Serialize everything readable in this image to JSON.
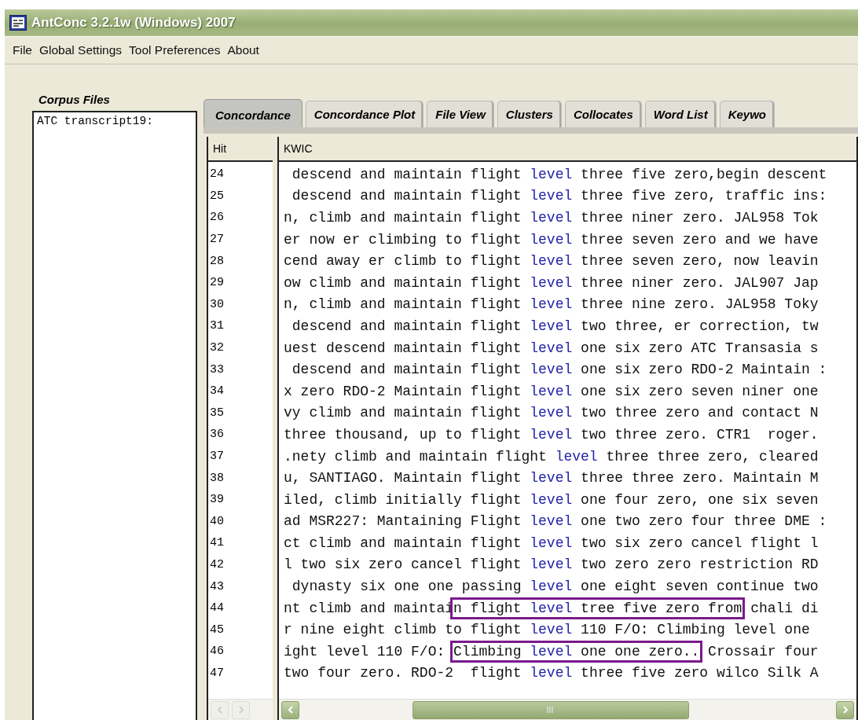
{
  "window": {
    "title": "AntConc 3.2.1w (Windows) 2007"
  },
  "menu": [
    "File",
    "Global Settings",
    "Tool Preferences",
    "About"
  ],
  "corpus_files": {
    "label": "Corpus Files",
    "items": [
      "ATC transcript19:"
    ]
  },
  "tabs": [
    {
      "label": "Concordance",
      "selected": true
    },
    {
      "label": "Concordance Plot",
      "selected": false
    },
    {
      "label": "File View",
      "selected": false
    },
    {
      "label": "Clusters",
      "selected": false
    },
    {
      "label": "Collocates",
      "selected": false
    },
    {
      "label": "Word List",
      "selected": false
    },
    {
      "label": "Keywo",
      "selected": false
    }
  ],
  "table": {
    "columns": [
      "Hit",
      "KWIC"
    ],
    "rows": [
      {
        "hit": "24",
        "parts": [
          {
            "text": " descend and maintain flight ",
            "kind": "context",
            "boxed": false
          },
          {
            "text": "level",
            "kind": "keyword",
            "boxed": false
          },
          {
            "text": " three five zero,begin descent",
            "kind": "context",
            "boxed": false
          }
        ]
      },
      {
        "hit": "25",
        "parts": [
          {
            "text": " descend and maintain flight ",
            "kind": "context",
            "boxed": false
          },
          {
            "text": "level",
            "kind": "keyword",
            "boxed": false
          },
          {
            "text": " three five zero, traffic ins:",
            "kind": "context",
            "boxed": false
          }
        ]
      },
      {
        "hit": "26",
        "parts": [
          {
            "text": "n, climb and maintain flight ",
            "kind": "context",
            "boxed": false
          },
          {
            "text": "level",
            "kind": "keyword",
            "boxed": false
          },
          {
            "text": " three niner zero. JAL958 Tok",
            "kind": "context",
            "boxed": false
          }
        ]
      },
      {
        "hit": "27",
        "parts": [
          {
            "text": "er now er climbing to flight ",
            "kind": "context",
            "boxed": false
          },
          {
            "text": "level",
            "kind": "keyword",
            "boxed": false
          },
          {
            "text": " three seven zero and we have",
            "kind": "context",
            "boxed": false
          }
        ]
      },
      {
        "hit": "28",
        "parts": [
          {
            "text": "cend away er climb to flight ",
            "kind": "context",
            "boxed": false
          },
          {
            "text": "level",
            "kind": "keyword",
            "boxed": false
          },
          {
            "text": " three seven zero, now leavin",
            "kind": "context",
            "boxed": false
          }
        ]
      },
      {
        "hit": "29",
        "parts": [
          {
            "text": "ow climb and maintain flight ",
            "kind": "context",
            "boxed": false
          },
          {
            "text": "level",
            "kind": "keyword",
            "boxed": false
          },
          {
            "text": " three niner zero. JAL907 Jap",
            "kind": "context",
            "boxed": false
          }
        ]
      },
      {
        "hit": "30",
        "parts": [
          {
            "text": "n, climb and maintain flight ",
            "kind": "context",
            "boxed": false
          },
          {
            "text": "level",
            "kind": "keyword",
            "boxed": false
          },
          {
            "text": " three nine zero. JAL958 Toky",
            "kind": "context",
            "boxed": false
          }
        ]
      },
      {
        "hit": "31",
        "parts": [
          {
            "text": " descend and maintain flight ",
            "kind": "context",
            "boxed": false
          },
          {
            "text": "level",
            "kind": "keyword",
            "boxed": false
          },
          {
            "text": " two three, er correction, tw",
            "kind": "context",
            "boxed": false
          }
        ]
      },
      {
        "hit": "32",
        "parts": [
          {
            "text": "uest descend maintain flight ",
            "kind": "context",
            "boxed": false
          },
          {
            "text": "level",
            "kind": "keyword",
            "boxed": false
          },
          {
            "text": " one six zero ATC Transasia s",
            "kind": "context",
            "boxed": false
          }
        ]
      },
      {
        "hit": "33",
        "parts": [
          {
            "text": " descend and maintain flight ",
            "kind": "context",
            "boxed": false
          },
          {
            "text": "level",
            "kind": "keyword",
            "boxed": false
          },
          {
            "text": " one six zero RDO-2 Maintain :",
            "kind": "context",
            "boxed": false
          }
        ]
      },
      {
        "hit": "34",
        "parts": [
          {
            "text": "x zero RDO-2 Maintain flight ",
            "kind": "context",
            "boxed": false
          },
          {
            "text": "level",
            "kind": "keyword",
            "boxed": false
          },
          {
            "text": " one six zero seven niner one",
            "kind": "context",
            "boxed": false
          }
        ]
      },
      {
        "hit": "35",
        "parts": [
          {
            "text": "vy climb and maintain flight ",
            "kind": "context",
            "boxed": false
          },
          {
            "text": "level",
            "kind": "keyword",
            "boxed": false
          },
          {
            "text": " two three zero and contact N",
            "kind": "context",
            "boxed": false
          }
        ]
      },
      {
        "hit": "36",
        "parts": [
          {
            "text": "three thousand, up to flight ",
            "kind": "context",
            "boxed": false
          },
          {
            "text": "level",
            "kind": "keyword",
            "boxed": false
          },
          {
            "text": " two three zero. CTR1  roger.",
            "kind": "context",
            "boxed": false
          }
        ]
      },
      {
        "hit": "37",
        "parts": [
          {
            "text": ".nety climb and maintain flight ",
            "kind": "context",
            "boxed": false
          },
          {
            "text": "level",
            "kind": "keyword",
            "boxed": false
          },
          {
            "text": " three three zero, cleared",
            "kind": "context",
            "boxed": false
          }
        ]
      },
      {
        "hit": "38",
        "parts": [
          {
            "text": "u, SANTIAGO. Maintain flight ",
            "kind": "context",
            "boxed": false
          },
          {
            "text": "level",
            "kind": "keyword",
            "boxed": false
          },
          {
            "text": " three three zero. Maintain M",
            "kind": "context",
            "boxed": false
          }
        ]
      },
      {
        "hit": "39",
        "parts": [
          {
            "text": "iled, climb initially flight ",
            "kind": "context",
            "boxed": false
          },
          {
            "text": "level",
            "kind": "keyword",
            "boxed": false
          },
          {
            "text": " one four zero, one six seven",
            "kind": "context",
            "boxed": false
          }
        ]
      },
      {
        "hit": "40",
        "parts": [
          {
            "text": "ad MSR227: Mantaining Flight ",
            "kind": "context",
            "boxed": false
          },
          {
            "text": "level",
            "kind": "keyword",
            "boxed": false
          },
          {
            "text": " one two zero four three DME :",
            "kind": "context",
            "boxed": false
          }
        ]
      },
      {
        "hit": "41",
        "parts": [
          {
            "text": "ct climb and maintain flight ",
            "kind": "context",
            "boxed": false
          },
          {
            "text": "level",
            "kind": "keyword",
            "boxed": false
          },
          {
            "text": " two six zero cancel flight l",
            "kind": "context",
            "boxed": false
          }
        ]
      },
      {
        "hit": "42",
        "parts": [
          {
            "text": "l two six zero cancel flight ",
            "kind": "context",
            "boxed": false
          },
          {
            "text": "level",
            "kind": "keyword",
            "boxed": false
          },
          {
            "text": " two zero zero restriction RD",
            "kind": "context",
            "boxed": false
          }
        ]
      },
      {
        "hit": "43",
        "parts": [
          {
            "text": " dynasty six one one passing ",
            "kind": "context",
            "boxed": false
          },
          {
            "text": "level",
            "kind": "keyword",
            "boxed": false
          },
          {
            "text": " one eight seven continue two",
            "kind": "context",
            "boxed": false
          }
        ]
      },
      {
        "hit": "44",
        "parts": [
          {
            "text": "nt climb and maintai",
            "kind": "context",
            "boxed": false
          },
          {
            "text": "n flight ",
            "kind": "context",
            "boxed": true
          },
          {
            "text": "level",
            "kind": "keyword",
            "boxed": true
          },
          {
            "text": " tree five zero from",
            "kind": "context",
            "boxed": true
          },
          {
            "text": " chali di",
            "kind": "context",
            "boxed": false
          }
        ]
      },
      {
        "hit": "45",
        "parts": [
          {
            "text": "r nine eight climb to flight ",
            "kind": "context",
            "boxed": false
          },
          {
            "text": "level",
            "kind": "keyword",
            "boxed": false
          },
          {
            "text": " 110 F/O: Climbing level one",
            "kind": "context",
            "boxed": false
          }
        ]
      },
      {
        "hit": "46",
        "parts": [
          {
            "text": "ight level 110 F/O: ",
            "kind": "context",
            "boxed": false
          },
          {
            "text": "Climbing ",
            "kind": "context",
            "boxed": true
          },
          {
            "text": "level",
            "kind": "keyword",
            "boxed": true
          },
          {
            "text": " one one zero..",
            "kind": "context",
            "boxed": true
          },
          {
            "text": " Crossair four",
            "kind": "context",
            "boxed": false
          }
        ]
      },
      {
        "hit": "47",
        "parts": [
          {
            "text": "two four zero. RDO-2  flight ",
            "kind": "context",
            "boxed": false
          },
          {
            "text": "level",
            "kind": "keyword",
            "boxed": false
          },
          {
            "text": " three five zero wilco Silk A",
            "kind": "context",
            "boxed": false
          }
        ]
      }
    ]
  }
}
